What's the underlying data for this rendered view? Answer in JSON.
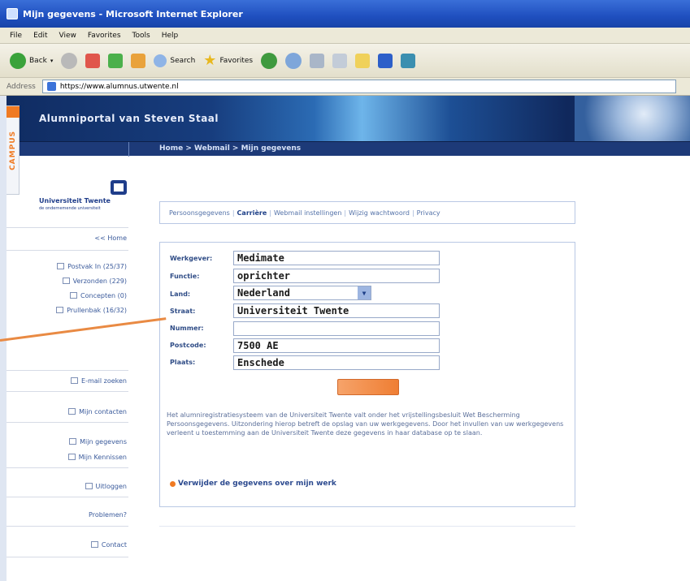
{
  "window": {
    "title": "Mijn gegevens - Microsoft Internet Explorer"
  },
  "menu": [
    "File",
    "Edit",
    "View",
    "Favorites",
    "Tools",
    "Help"
  ],
  "toolbar": {
    "back_label": "Back",
    "search_label": "Search",
    "favorites_label": "Favorites"
  },
  "address": {
    "label": "Address",
    "url": "https://www.alumnus.utwente.nl"
  },
  "banner": {
    "title": "Alumniportal van Steven Staal",
    "breadcrumb": "Home > Webmail > Mijn gegevens",
    "campus_tab": "CAMPUS"
  },
  "logo": {
    "name": "Universiteit Twente",
    "tagline": "de ondernemende universiteit"
  },
  "sidebar": {
    "home": "<< Home",
    "inbox": "Postvak In (25/37)",
    "sent": "Verzonden (229)",
    "concepts": "Concepten (0)",
    "trash": "Prullenbak (16/32)",
    "email_search": "E-mail zoeken",
    "contacts": "Mijn contacten",
    "my_data": "Mijn gegevens",
    "my_friends": "Mijn Kennissen",
    "logout": "Uitloggen",
    "problems": "Problemen?",
    "contact": "Contact"
  },
  "tabs": {
    "personal": "Persoonsgegevens",
    "career": "Carrière",
    "webmail_settings": "Webmail instellingen",
    "change_password": "Wijzig wachtwoord",
    "privacy": "Privacy"
  },
  "form": {
    "employer_label": "Werkgever:",
    "employer_value": "Medimate",
    "function_label": "Functie:",
    "function_value": "oprichter",
    "country_label": "Land:",
    "country_value": "Nederland",
    "street_label": "Straat:",
    "street_value": "Universiteit Twente",
    "number_label": "Nummer:",
    "number_value": "",
    "postcode_label": "Postcode:",
    "postcode_value": "7500 AE",
    "city_label": "Plaats:",
    "city_value": "Enschede"
  },
  "info": {
    "text": "Het alumniregistratiesysteem van de Universiteit Twente valt onder het vrijstellingsbesluit Wet Bescherming Persoonsgegevens. Uitzondering hierop betreft de opslag van uw werkgegevens. Door het invullen van uw werkgegevens verleent u toestemming aan de Universiteit Twente deze gegevens in haar database op te slaan.",
    "delete_link": "Verwijder de gegevens over mijn werk"
  },
  "colors": {
    "accent_orange": "#ef7e33",
    "nav_blue": "#1d3a78",
    "link_blue": "#2c4a8f"
  }
}
